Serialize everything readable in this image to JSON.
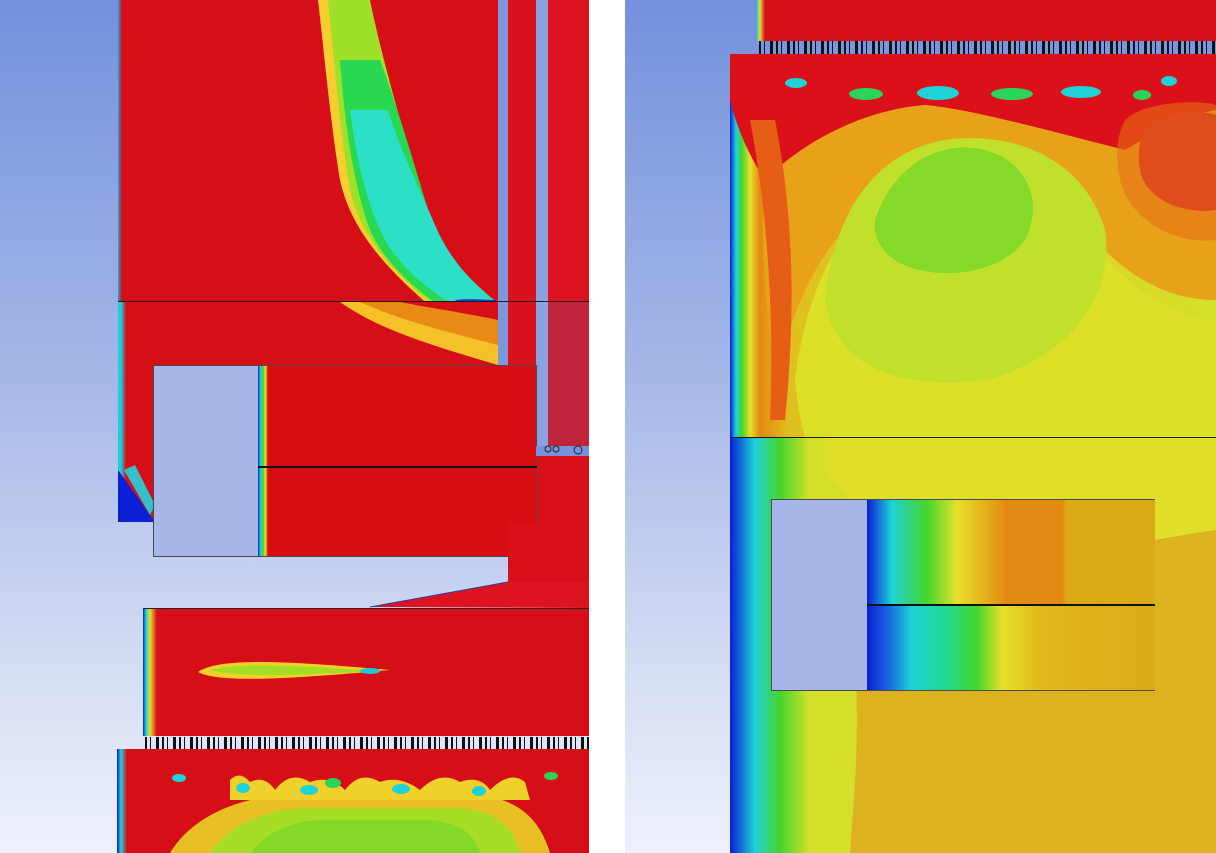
{
  "figure": {
    "panels": [
      {
        "id": "left",
        "view": "overview"
      },
      {
        "id": "right",
        "view": "zoom"
      }
    ],
    "colormap": {
      "low": "#0a1fd6",
      "mid_low": "#1ed2d8",
      "mid": "#44d62a",
      "mid_high": "#e6e02a",
      "high_mid": "#e48a12",
      "high": "#dc1018"
    },
    "background": {
      "top": "#7391dd",
      "bottom": "#eef1fb"
    },
    "inset_fill": "#a6b6e8"
  }
}
